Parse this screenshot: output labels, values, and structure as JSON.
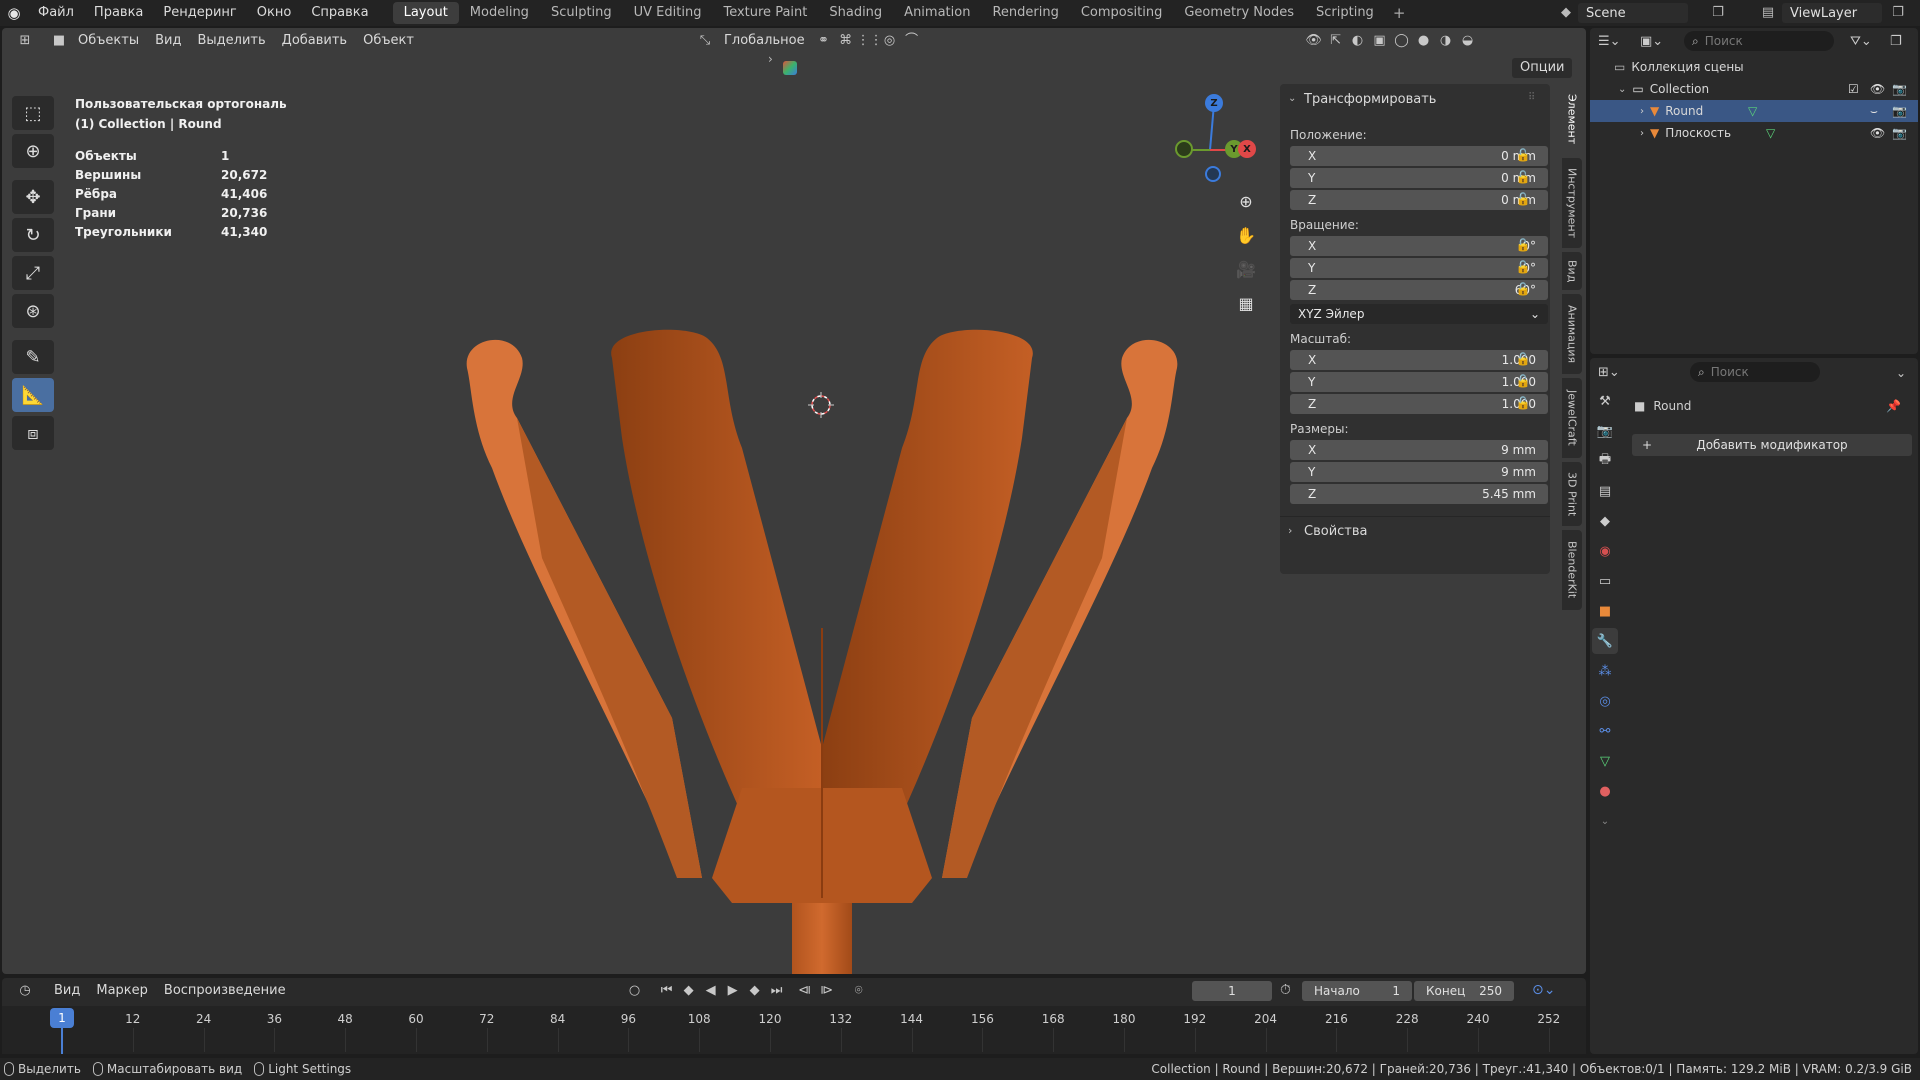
{
  "menubar": {
    "items": [
      "Файл",
      "Правка",
      "Рендеринг",
      "Окно",
      "Справка"
    ],
    "workspaces": [
      "Layout",
      "Modeling",
      "Sculpting",
      "UV Editing",
      "Texture Paint",
      "Shading",
      "Animation",
      "Rendering",
      "Compositing",
      "Geometry Nodes",
      "Scripting"
    ],
    "active_workspace": "Layout",
    "scene": "Scene",
    "view_layer": "ViewLayer"
  },
  "viewport_header": {
    "mode": "Объекты",
    "menus": [
      "Вид",
      "Выделить",
      "Добавить",
      "Объект"
    ],
    "orientation": "Глобальное",
    "options": "Опции"
  },
  "viewport_overlay": {
    "view_name": "Пользовательская ортогональ",
    "collection_line": "(1) Collection | Round",
    "stats": [
      {
        "label": "Объекты",
        "value": "1"
      },
      {
        "label": "Вершины",
        "value": "20,672"
      },
      {
        "label": "Рёбра",
        "value": "41,406"
      },
      {
        "label": "Грани",
        "value": "20,736"
      },
      {
        "label": "Треугольники",
        "value": "41,340"
      }
    ]
  },
  "gizmo": {
    "z": "Z",
    "y": "Y",
    "x": "X"
  },
  "npanel": {
    "section_title": "Трансформировать",
    "location_label": "Положение:",
    "location": [
      {
        "axis": "X",
        "value": "0 mm"
      },
      {
        "axis": "Y",
        "value": "0 mm"
      },
      {
        "axis": "Z",
        "value": "0 mm"
      }
    ],
    "rotation_label": "Вращение:",
    "rotation": [
      {
        "axis": "X",
        "value": "0°"
      },
      {
        "axis": "Y",
        "value": "0°"
      },
      {
        "axis": "Z",
        "value": "60°"
      }
    ],
    "rotation_mode": "XYZ Эйлер",
    "scale_label": "Масштаб:",
    "scale": [
      {
        "axis": "X",
        "value": "1.000"
      },
      {
        "axis": "Y",
        "value": "1.000"
      },
      {
        "axis": "Z",
        "value": "1.000"
      }
    ],
    "dimensions_label": "Размеры:",
    "dimensions": [
      {
        "axis": "X",
        "value": "9 mm"
      },
      {
        "axis": "Y",
        "value": "9 mm"
      },
      {
        "axis": "Z",
        "value": "5.45 mm"
      }
    ],
    "properties_label": "Свойства",
    "tabs": [
      "Элемент",
      "Инструмент",
      "Вид",
      "Анимация",
      "JewelCraft",
      "3D Print",
      "BlenderKit"
    ]
  },
  "outliner": {
    "search_placeholder": "Поиск",
    "scene_collection": "Коллекция сцены",
    "collection": "Collection",
    "objects": [
      {
        "name": "Round",
        "selected": true
      },
      {
        "name": "Плоскость",
        "selected": false
      }
    ]
  },
  "properties": {
    "search_placeholder": "Поиск",
    "object_name": "Round",
    "add_modifier": "Добавить модификатор"
  },
  "timeline": {
    "menus": [
      "Вид",
      "Маркер",
      "Воспроизведение"
    ],
    "current_frame": "1",
    "start_label": "Начало",
    "start": "1",
    "end_label": "Конец",
    "end": "250",
    "ruler": [
      "12",
      "24",
      "36",
      "48",
      "60",
      "72",
      "84",
      "96",
      "108",
      "120",
      "132",
      "144",
      "156",
      "168",
      "180",
      "192",
      "204",
      "216",
      "228",
      "240",
      "252"
    ]
  },
  "statusbar": {
    "hints": [
      "Выделить",
      "Масштабировать вид",
      "Light Settings"
    ],
    "info": "Collection | Round | Вершин:20,672 | Граней:20,736 | Треуг.:41,340 | Объектов:0/1 | Память: 129.2 MiB | VRAM: 0.2/3.9 GiB"
  },
  "colors": {
    "accent": "#4a6fa1",
    "selection": "#3a5785",
    "object": "#c8642a"
  }
}
